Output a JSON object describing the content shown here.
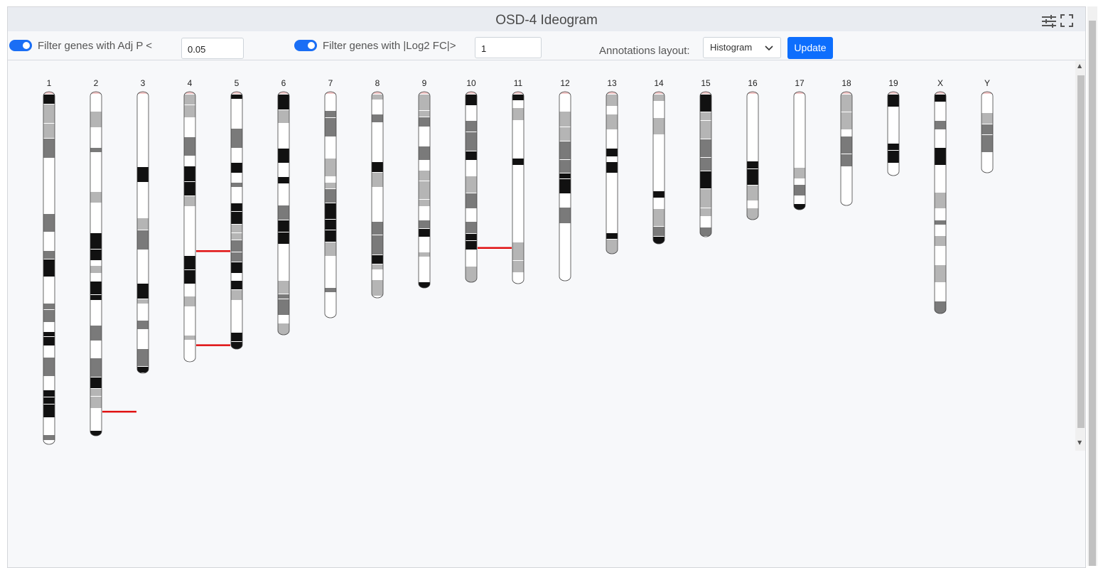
{
  "header": {
    "title": "OSD-4 Ideogram",
    "settings_icon": "sliders-icon",
    "fullscreen_icon": "fullscreen-icon"
  },
  "toolbar": {
    "filter_adjp": {
      "label": "Filter genes with Adj P <",
      "enabled": true,
      "value": "0.05"
    },
    "filter_fc": {
      "label": "Filter genes with |Log2 FC|>",
      "enabled": true,
      "value": "1"
    },
    "layout_label": "Annotations layout:",
    "layout_selected": "Histogram",
    "update_label": "Update"
  },
  "colors": {
    "accent": "#0d6efd",
    "annotation": "#e01010",
    "band_dark": "#111111",
    "band_mid": "#7a7a7a",
    "band_light": "#b5b5b5"
  },
  "chromosomes": [
    {
      "name": "1",
      "length": 248
    },
    {
      "name": "2",
      "length": 242
    },
    {
      "name": "3",
      "length": 198
    },
    {
      "name": "4",
      "length": 190
    },
    {
      "name": "5",
      "length": 181
    },
    {
      "name": "6",
      "length": 171
    },
    {
      "name": "7",
      "length": 159
    },
    {
      "name": "8",
      "length": 145
    },
    {
      "name": "9",
      "length": 138
    },
    {
      "name": "10",
      "length": 134
    },
    {
      "name": "11",
      "length": 135
    },
    {
      "name": "12",
      "length": 133
    },
    {
      "name": "13",
      "length": 114
    },
    {
      "name": "14",
      "length": 107
    },
    {
      "name": "15",
      "length": 102
    },
    {
      "name": "16",
      "length": 90
    },
    {
      "name": "17",
      "length": 83
    },
    {
      "name": "18",
      "length": 80
    },
    {
      "name": "19",
      "length": 59
    },
    {
      "name": "X",
      "length": 156
    },
    {
      "name": "Y",
      "length": 57
    }
  ],
  "annotations": [
    {
      "chromosome": "2",
      "position": 0.93,
      "side": "right"
    },
    {
      "chromosome": "4",
      "position": 0.59,
      "side": "right"
    },
    {
      "chromosome": "5",
      "position": 0.985,
      "side": "left"
    },
    {
      "chromosome": "10",
      "position": 0.82,
      "side": "right"
    }
  ]
}
